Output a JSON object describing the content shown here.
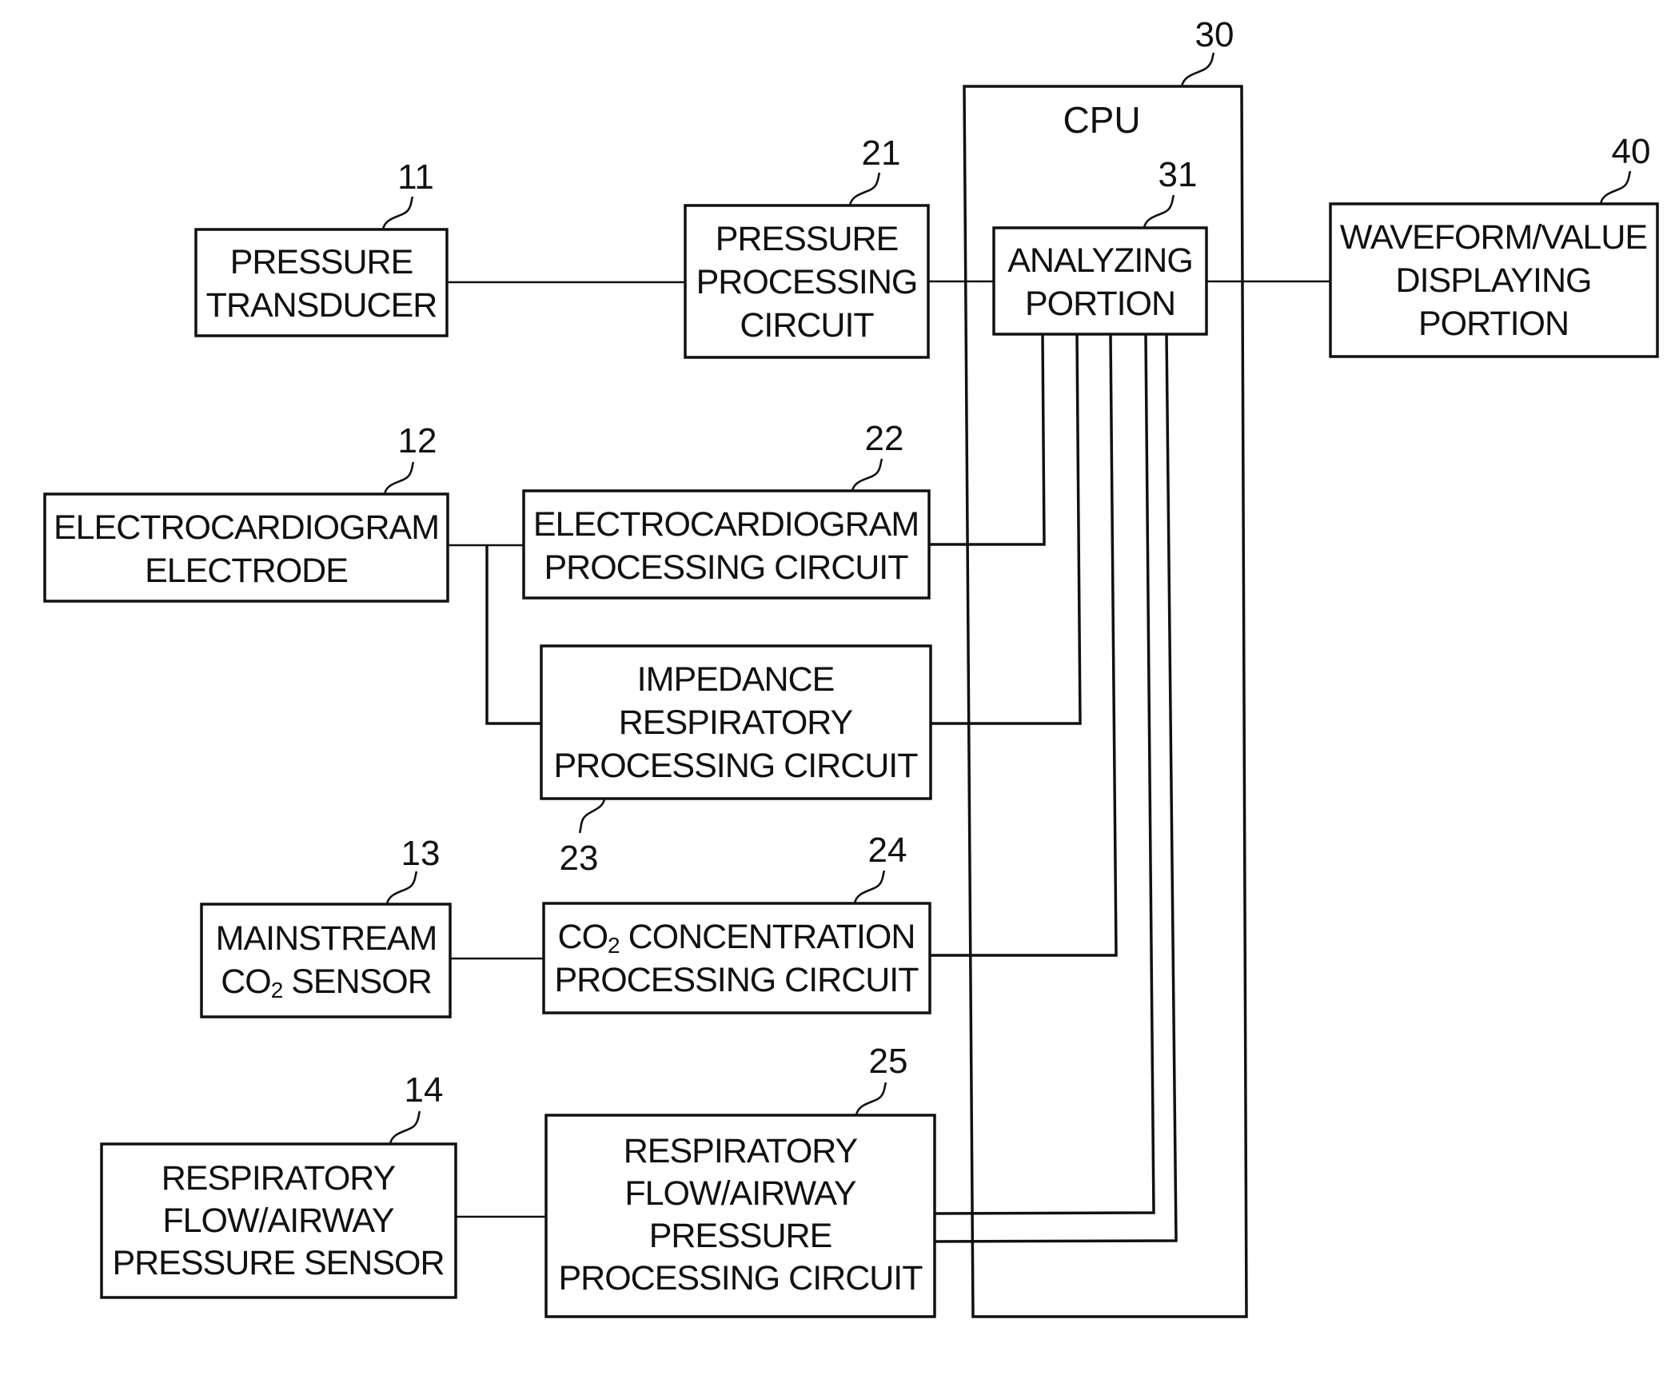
{
  "figure": {
    "type": "block-diagram",
    "cpu": {
      "ref": "30",
      "title": "CPU"
    },
    "blocks": [
      {
        "id": "pressure-transducer",
        "ref": "11",
        "lines": [
          "PRESSURE",
          "TRANSDUCER"
        ]
      },
      {
        "id": "ecg-electrode",
        "ref": "12",
        "lines": [
          "ELECTROCARDIOGRAM",
          "ELECTRODE"
        ]
      },
      {
        "id": "mainstream-co2-sensor",
        "ref": "13",
        "lines": [
          "MAINSTREAM",
          "CO2 SENSOR"
        ]
      },
      {
        "id": "respiratory-flow-sensor",
        "ref": "14",
        "lines": [
          "RESPIRATORY",
          "FLOW/AIRWAY",
          "PRESSURE SENSOR"
        ]
      },
      {
        "id": "pressure-processing-circuit",
        "ref": "21",
        "lines": [
          "PRESSURE",
          "PROCESSING",
          "CIRCUIT"
        ]
      },
      {
        "id": "ecg-processing-circuit",
        "ref": "22",
        "lines": [
          "ELECTROCARDIOGRAM",
          "PROCESSING CIRCUIT"
        ]
      },
      {
        "id": "impedance-respiratory-circuit",
        "ref": "23",
        "lines": [
          "IMPEDANCE",
          "RESPIRATORY",
          "PROCESSING CIRCUIT"
        ]
      },
      {
        "id": "co2-concentration-circuit",
        "ref": "24",
        "lines": [
          "CO2 CONCENTRATION",
          "PROCESSING CIRCUIT"
        ]
      },
      {
        "id": "respiratory-flow-circuit",
        "ref": "25",
        "lines": [
          "RESPIRATORY",
          "FLOW/AIRWAY",
          "PRESSURE",
          "PROCESSING CIRCUIT"
        ]
      },
      {
        "id": "analyzing-portion",
        "ref": "31",
        "lines": [
          "ANALYZING",
          "PORTION"
        ]
      },
      {
        "id": "waveform-display",
        "ref": "40",
        "lines": [
          "WAVEFORM/VALUE",
          "DISPLAYING",
          "PORTION"
        ]
      }
    ],
    "connections": [
      [
        "pressure-transducer",
        "pressure-processing-circuit"
      ],
      [
        "pressure-processing-circuit",
        "analyzing-portion"
      ],
      [
        "analyzing-portion",
        "waveform-display"
      ],
      [
        "ecg-electrode",
        "ecg-processing-circuit"
      ],
      [
        "ecg-electrode",
        "impedance-respiratory-circuit"
      ],
      [
        "ecg-processing-circuit",
        "analyzing-portion"
      ],
      [
        "impedance-respiratory-circuit",
        "analyzing-portion"
      ],
      [
        "mainstream-co2-sensor",
        "co2-concentration-circuit"
      ],
      [
        "co2-concentration-circuit",
        "analyzing-portion"
      ],
      [
        "respiratory-flow-sensor",
        "respiratory-flow-circuit"
      ],
      [
        "respiratory-flow-circuit",
        "analyzing-portion"
      ],
      [
        "respiratory-flow-circuit",
        "analyzing-portion"
      ]
    ]
  }
}
